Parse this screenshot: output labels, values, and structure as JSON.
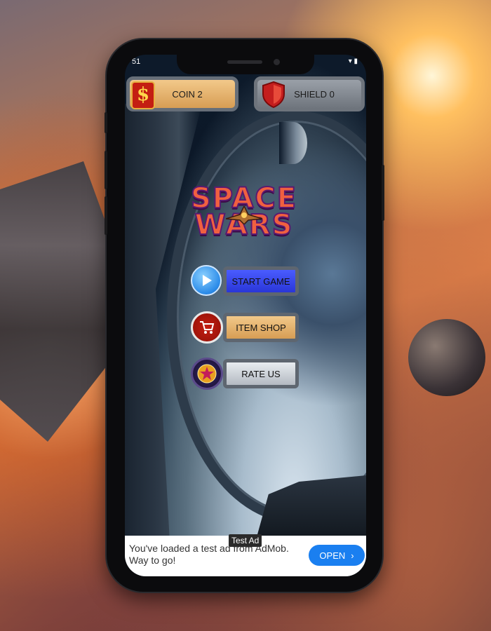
{
  "status_bar": {
    "time": "51",
    "right": "▾ ▮"
  },
  "hud": {
    "coin_label": "COIN 2",
    "coin_symbol": "$",
    "shield_label": "SHIELD 0"
  },
  "title": {
    "line1": "SPACE",
    "line2": "WARS"
  },
  "menu": {
    "start_label": "START GAME",
    "shop_label": "ITEM SHOP",
    "rate_label": "RATE US"
  },
  "ad": {
    "tag": "Test Ad",
    "message": "You've loaded a test ad from AdMob. Way to go!",
    "open_label": "OPEN",
    "open_chevron": "›"
  },
  "colors": {
    "accent_blue": "#2a36d8",
    "coin_gold": "#d79d54",
    "ad_button": "#1a7ff0"
  }
}
